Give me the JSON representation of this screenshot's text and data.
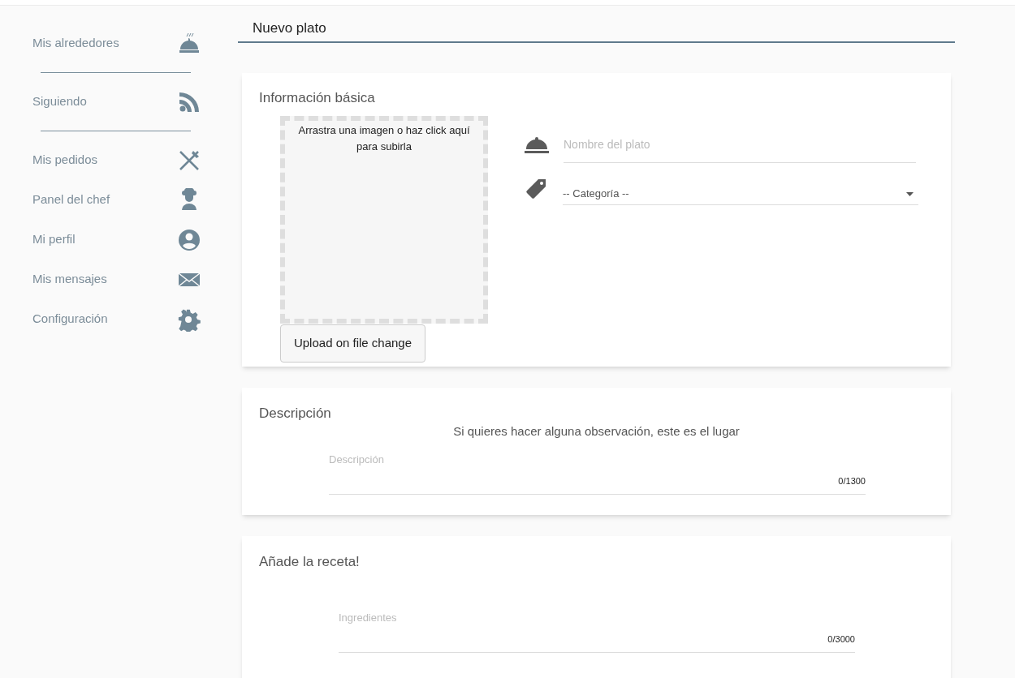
{
  "sidebar": {
    "items": [
      {
        "label": "Mis alrededores"
      },
      {
        "label": "Siguiendo"
      },
      {
        "label": "Mis pedidos"
      },
      {
        "label": "Panel del chef"
      },
      {
        "label": "Mi perfil"
      },
      {
        "label": "Mis mensajes"
      },
      {
        "label": "Configuración"
      }
    ]
  },
  "page_title": "Nuevo plato",
  "basic_info": {
    "title": "Información básica",
    "dropzone_text": "Arrastra una imagen o haz click aquí para subirla",
    "upload_button": "Upload on file change",
    "name_field": {
      "placeholder": "Nombre del plato"
    },
    "category_select": {
      "value": "-- Categoría --"
    }
  },
  "description": {
    "title": "Descripción",
    "hint": "Si quieres hacer alguna observación, este es el lugar",
    "field": {
      "placeholder": "Descripción",
      "counter": "0/1300"
    }
  },
  "recipe": {
    "title": "Añade la receta!",
    "field": {
      "placeholder": "Ingredientes",
      "counter": "0/3000"
    }
  }
}
